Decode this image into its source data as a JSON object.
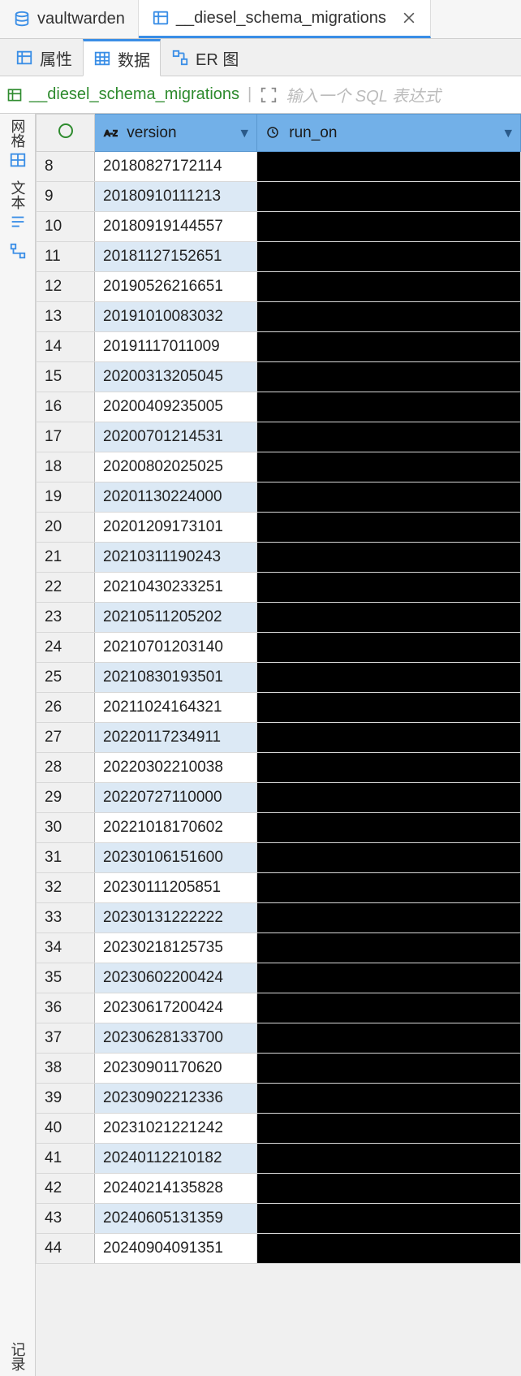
{
  "editorTabs": {
    "db": {
      "label": "vaultwarden"
    },
    "table": {
      "label": "__diesel_schema_migrations"
    }
  },
  "subTabs": {
    "props": "属性",
    "data": "数据",
    "er": "ER 图"
  },
  "crumb": {
    "table": "__diesel_schema_migrations",
    "sqlHint": "输入一个 SQL 表达式"
  },
  "leftGutter": {
    "grid": "网格",
    "text": "文本",
    "record": "记录"
  },
  "columns": {
    "version": "version",
    "run_on": "run_on"
  },
  "rows": [
    {
      "n": "8",
      "version": "20180827172114"
    },
    {
      "n": "9",
      "version": "20180910111213"
    },
    {
      "n": "10",
      "version": "20180919144557"
    },
    {
      "n": "11",
      "version": "20181127152651"
    },
    {
      "n": "12",
      "version": "20190526216651"
    },
    {
      "n": "13",
      "version": "20191010083032"
    },
    {
      "n": "14",
      "version": "20191117011009"
    },
    {
      "n": "15",
      "version": "20200313205045"
    },
    {
      "n": "16",
      "version": "20200409235005"
    },
    {
      "n": "17",
      "version": "20200701214531"
    },
    {
      "n": "18",
      "version": "20200802025025"
    },
    {
      "n": "19",
      "version": "20201130224000"
    },
    {
      "n": "20",
      "version": "20201209173101"
    },
    {
      "n": "21",
      "version": "20210311190243"
    },
    {
      "n": "22",
      "version": "20210430233251"
    },
    {
      "n": "23",
      "version": "20210511205202"
    },
    {
      "n": "24",
      "version": "20210701203140"
    },
    {
      "n": "25",
      "version": "20210830193501"
    },
    {
      "n": "26",
      "version": "20211024164321"
    },
    {
      "n": "27",
      "version": "20220117234911"
    },
    {
      "n": "28",
      "version": "20220302210038"
    },
    {
      "n": "29",
      "version": "20220727110000"
    },
    {
      "n": "30",
      "version": "20221018170602"
    },
    {
      "n": "31",
      "version": "20230106151600"
    },
    {
      "n": "32",
      "version": "20230111205851"
    },
    {
      "n": "33",
      "version": "20230131222222"
    },
    {
      "n": "34",
      "version": "20230218125735"
    },
    {
      "n": "35",
      "version": "20230602200424"
    },
    {
      "n": "36",
      "version": "20230617200424"
    },
    {
      "n": "37",
      "version": "20230628133700"
    },
    {
      "n": "38",
      "version": "20230901170620"
    },
    {
      "n": "39",
      "version": "20230902212336"
    },
    {
      "n": "40",
      "version": "20231021221242"
    },
    {
      "n": "41",
      "version": "20240112210182"
    },
    {
      "n": "42",
      "version": "20240214135828"
    },
    {
      "n": "43",
      "version": "20240605131359"
    },
    {
      "n": "44",
      "version": "20240904091351"
    }
  ]
}
